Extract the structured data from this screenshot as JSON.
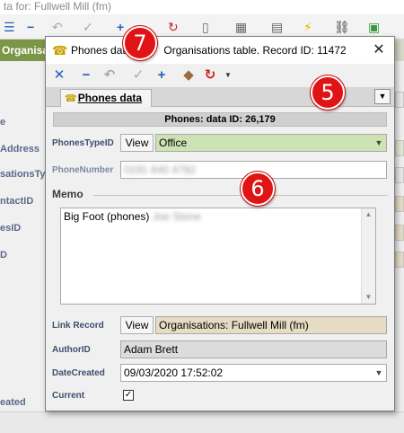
{
  "background_window": {
    "title": "ta for: Fullwell Mill (fm)",
    "tab_label": "Organisat",
    "labels": [
      "e",
      "Address",
      "sationsType",
      "ntactID",
      "esID",
      "D",
      "eated"
    ]
  },
  "dialog": {
    "title_left": "Phones data",
    "title_right": "Organisations table. Record ID: 11472",
    "close_glyph": "✕",
    "tab_label": "Phones data",
    "header": "Phones: data ID: 26,179",
    "phones_type": {
      "label": "PhonesTypeID",
      "view_label": "View",
      "value": "Office"
    },
    "phone_number": {
      "label": "PhoneNumber",
      "value": "0191 640 4782"
    },
    "memo": {
      "title": "Memo",
      "text_visible": "Big Foot (phones)",
      "text_redacted": "Joe Stone"
    },
    "link_record": {
      "label": "Link Record",
      "view_label": "View",
      "value": "Organisations: Fullwell Mill (fm)"
    },
    "author": {
      "label": "AuthorID",
      "value": "Adam Brett"
    },
    "date_created": {
      "label": "DateCreated",
      "value": "09/03/2020 17:52:02"
    },
    "current": {
      "label": "Current",
      "checked_glyph": "✓"
    }
  },
  "badges": {
    "b5": "5",
    "b6": "6",
    "b7": "7"
  },
  "icons": {
    "delete": "close-icon",
    "remove": "minus-icon",
    "undo": "undo-icon",
    "confirm": "check-icon",
    "add": "plus-icon",
    "eraser": "eraser-icon",
    "refresh": "refresh-icon",
    "dropdown": "chevron-down-icon"
  },
  "colors": {
    "type_field_bg": "#cde3b4",
    "link_field_bg": "#e6dcc3",
    "author_field_bg": "#dcdcdc",
    "badge": "#e01414",
    "bg_tab": "#7a9646"
  }
}
